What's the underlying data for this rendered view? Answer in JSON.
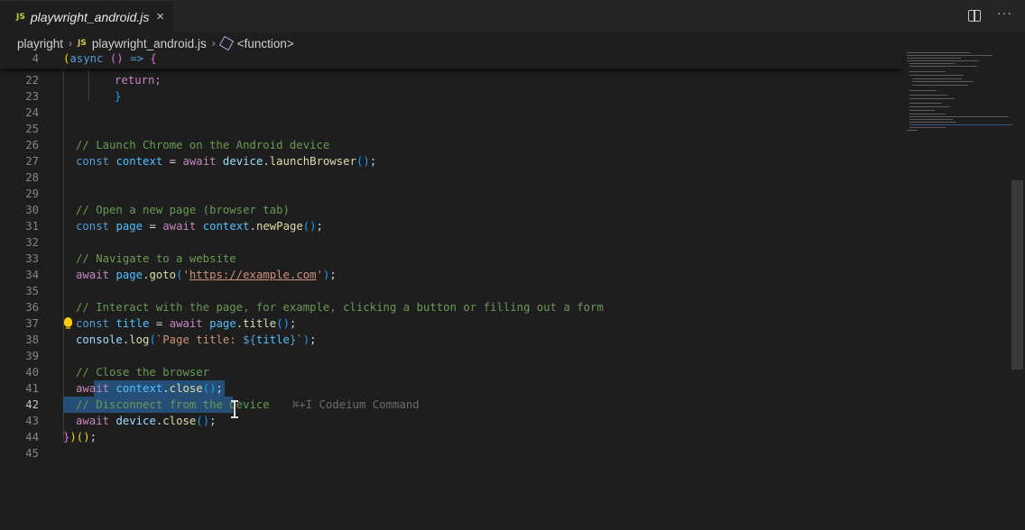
{
  "tab": {
    "badge": "JS",
    "name": "playwright_android.js",
    "close": "×"
  },
  "breadcrumb": {
    "folder": "playright",
    "badge": "JS",
    "file": "playwright_android.js",
    "symbol": "<function>"
  },
  "lines": {
    "l4": "4",
    "l22": "22",
    "l23": "23",
    "l24": "24",
    "l25": "25",
    "l26": "26",
    "l27": "27",
    "l28": "28",
    "l29": "29",
    "l30": "30",
    "l31": "31",
    "l32": "32",
    "l33": "33",
    "l34": "34",
    "l35": "35",
    "l36": "36",
    "l37": "37",
    "l38": "38",
    "l39": "39",
    "l40": "40",
    "l41": "41",
    "l42": "42",
    "l43": "43",
    "l44": "44",
    "l45": "45"
  },
  "code": {
    "c4": "(async () => {",
    "c22": "return;",
    "c23": "}",
    "c26": "// Launch Chrome on the Android device",
    "c30": "// Open a new page (browser tab)",
    "c33": "// Navigate to a website",
    "c34_url": "https://example.com",
    "c36": "// Interact with the page, for example, clicking a button or filling out a form",
    "c38_tpl": "Page title: ",
    "c40": "// Close the browser",
    "c42": "// Disconnect from the device",
    "c42_hint": "⌘+I Codeium Command",
    "c44": "})();"
  },
  "colors": {
    "background": "#1e1e1e",
    "selection": "#264f78",
    "comment": "#6a9955",
    "keyword": "#c586c0",
    "string": "#ce9178"
  }
}
